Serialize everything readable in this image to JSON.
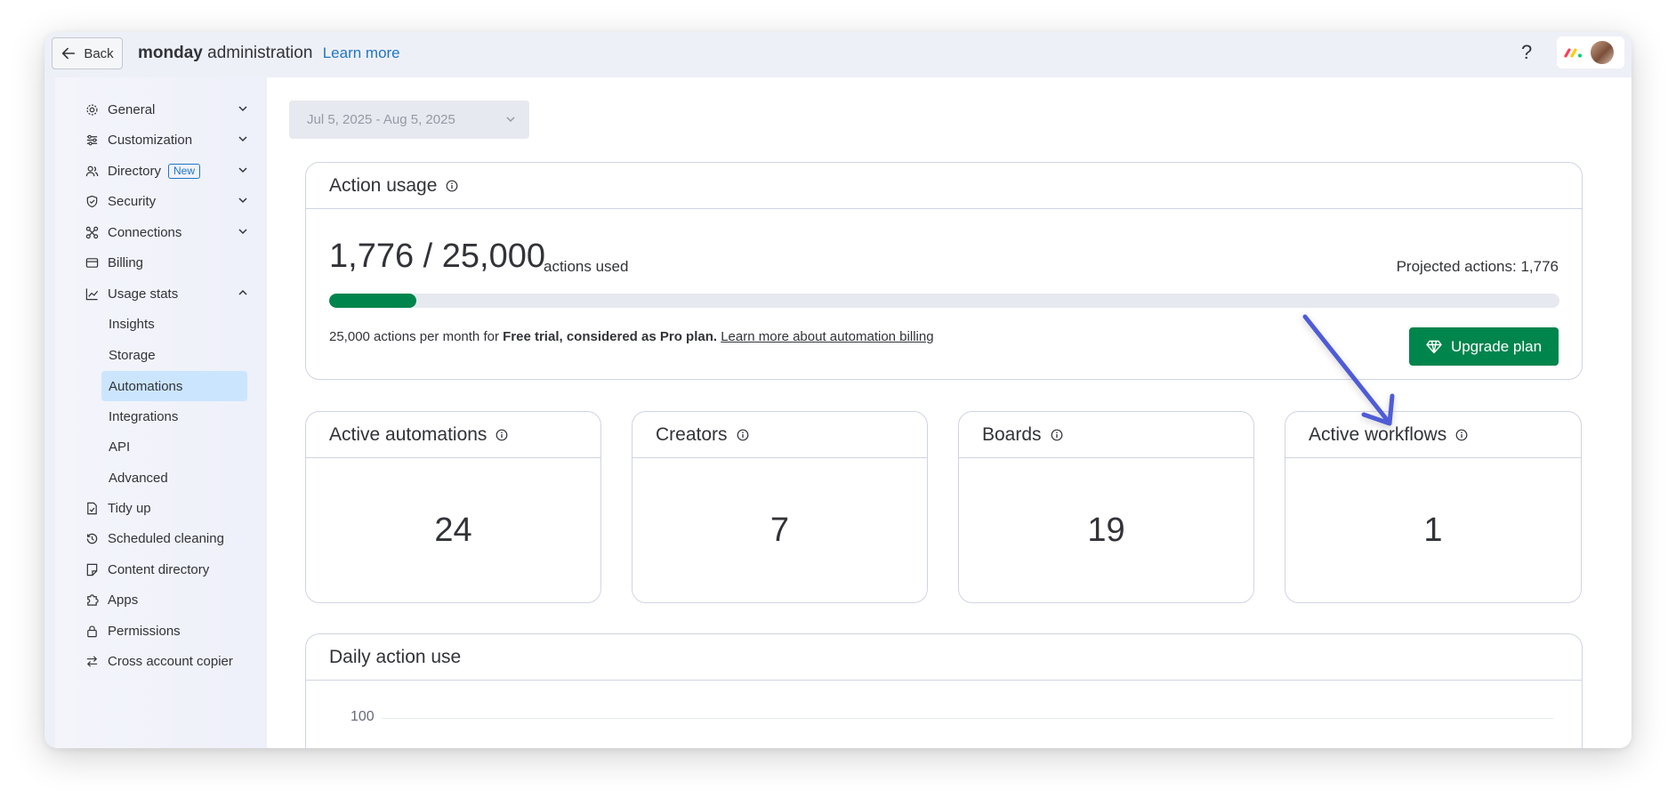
{
  "topbar": {
    "back_label": "Back",
    "brand_bold": "monday",
    "brand_rest": " administration",
    "learn_more": "Learn more",
    "help_label": "?"
  },
  "sidebar": {
    "items": [
      {
        "label": "General",
        "icon": "gear-icon"
      },
      {
        "label": "Customization",
        "icon": "sliders-icon"
      },
      {
        "label": "Directory",
        "icon": "users-icon",
        "badge": "New"
      },
      {
        "label": "Security",
        "icon": "shield-icon"
      },
      {
        "label": "Connections",
        "icon": "connections-icon"
      },
      {
        "label": "Billing",
        "icon": "credit-card-icon"
      },
      {
        "label": "Usage stats",
        "icon": "chart-icon"
      }
    ],
    "usage_sub": [
      "Insights",
      "Storage",
      "Automations",
      "Integrations",
      "API",
      "Advanced"
    ],
    "bottom_items": [
      {
        "label": "Tidy up",
        "icon": "tidy-icon"
      },
      {
        "label": "Scheduled cleaning",
        "icon": "history-icon"
      },
      {
        "label": "Content directory",
        "icon": "document-icon"
      },
      {
        "label": "Apps",
        "icon": "puzzle-icon"
      },
      {
        "label": "Permissions",
        "icon": "lock-icon"
      },
      {
        "label": "Cross account copier",
        "icon": "swap-icon"
      }
    ]
  },
  "main": {
    "date_range": "Jul 5, 2025 - Aug 5, 2025",
    "action_usage": {
      "title": "Action usage",
      "used": "1,776 / 25,000",
      "used_label": "actions used",
      "projected": "Projected actions: 1,776",
      "progress_fraction": 0.071,
      "plan_prefix": "25,000 actions per month for ",
      "plan_bold": "Free trial, considered as Pro plan.",
      "plan_link": "Learn more about automation billing",
      "upgrade_label": "Upgrade plan"
    },
    "stats": [
      {
        "title": "Active automations",
        "value": "24"
      },
      {
        "title": "Creators",
        "value": "7"
      },
      {
        "title": "Boards",
        "value": "19"
      },
      {
        "title": "Active workflows",
        "value": "1"
      }
    ],
    "daily": {
      "title": "Daily action use",
      "tick_top": "100"
    }
  },
  "colors": {
    "accent_green": "#00854d",
    "link_blue": "#1f76c2",
    "active_nav": "#cce5ff",
    "annotation_arrow": "#4f5bd5"
  }
}
